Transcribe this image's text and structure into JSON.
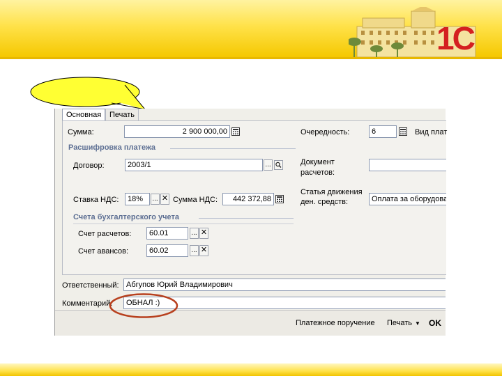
{
  "slide": {
    "logo_text": "1С",
    "colors": {
      "accent_yellow": "#ffe24a",
      "oval_red": "#b8401e",
      "bubble_yellow": "#ffff33"
    }
  },
  "form": {
    "tabs": [
      "Основная",
      "Печать"
    ],
    "amount": {
      "label": "Сумма:",
      "value": "2 900 000,00"
    },
    "priority": {
      "label": "Очередность:",
      "value": "6"
    },
    "payment_type": {
      "label": "Вид плат"
    },
    "section_decoding": "Расшифровка платежа",
    "contract": {
      "label": "Договор:",
      "value": "2003/1"
    },
    "settlement_doc": {
      "label_line1": "Документ",
      "label_line2": "расчетов:",
      "value": ""
    },
    "vat_rate": {
      "label": "Ставка НДС:",
      "value": "18%"
    },
    "vat_amount": {
      "label": "Сумма НДС:",
      "value": "442 372,88"
    },
    "cash_flow": {
      "label_line1": "Статья движения",
      "label_line2": "ден. средств:",
      "value": "Оплата за оборудова"
    },
    "section_accounts": "Счета бухгалтерского учета",
    "settlement_account": {
      "label": "Счет расчетов:",
      "value": "60.01"
    },
    "advance_account": {
      "label": "Счет авансов:",
      "value": "60.02"
    },
    "responsible": {
      "label": "Ответственный:",
      "value": "Абгупов Юрий Владимирович"
    },
    "comment": {
      "label": "Комментарий:",
      "value": "ОБНАЛ :)"
    },
    "bottom": {
      "payment_order": "Платежное поручение",
      "print": "Печать",
      "ok": "OK"
    },
    "icons": {
      "select": "...",
      "clear": "✕",
      "search": "search-icon",
      "calculator": "calculator-icon"
    }
  }
}
